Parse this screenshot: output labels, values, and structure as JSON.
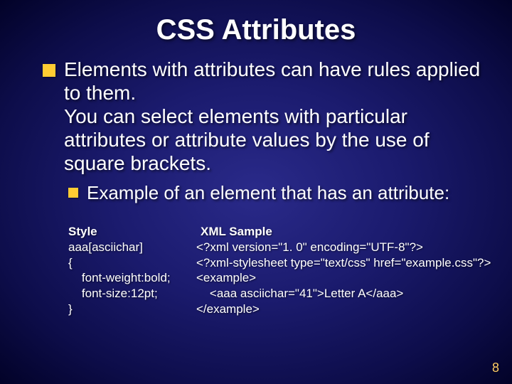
{
  "title": "CSS Attributes",
  "main_bullet": "Elements with attributes can have rules applied to them.\nYou can select elements with particular attributes or attribute values by the use of square brackets.",
  "sub_bullet": "Example of an element that has an attribute:",
  "columns": {
    "left_header": "Style",
    "right_header": "XML Sample",
    "left_code": "aaa[asciichar]\n{\n    font-weight:bold;\n    font-size:12pt;\n}",
    "right_code": "<?xml version=\"1. 0\" encoding=\"UTF-8\"?>\n<?xml-stylesheet type=\"text/css\" href=\"example.css\"?>\n<example>\n    <aaa asciichar=\"41\">Letter A</aaa>\n</example>"
  },
  "page_number": "8"
}
